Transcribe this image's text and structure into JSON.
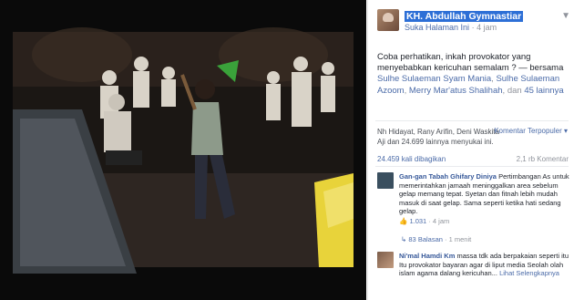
{
  "post": {
    "page_name": "KH. Abdullah Gymnastiar",
    "like_page": "Suka Halaman Ini",
    "time": "4 jam",
    "text": "Coba perhatikan, inkah provokator yang menyebabkan kericuhan semalam ? — bersama",
    "tagged_1": "Sulhe Sulaeman Syam Mania",
    "tagged_2": "Sulhe Sulaeman Azoom",
    "tagged_3": "Merry Mar'atus Shalihah",
    "and_word": "dan",
    "others": "45 lainnya",
    "likers": "Nh Hidayat, Rany Arifin, Deni Waskita Aji dan 24.699 lainnya menyukai ini.",
    "comment_filter": "Komentar Terpopuler",
    "shares": "24.459 kali dibagikan",
    "views": "2,1 rb Komentar"
  },
  "comments": [
    {
      "author": "Gan-gan Tabah Ghifary Diniya",
      "text": "Pertimbangan As untuk memerintahkan jamaah meninggalkan area sebelum gelap memang tepat. Syetan dan fitnah lebih mudah masuk di saat gelap. Sama seperti ketika hati sedang gelap.",
      "likes": "1.031",
      "time": "4 jam",
      "replies": "83 Balasan",
      "reply_time": "1 menit"
    },
    {
      "author": "Ni'mal Hamdi Km",
      "text": "massa tdk ada berpakaian seperti itu Itu provokator bayaran agar di liput media Seolah olah islam agama dalang kericuhan...",
      "more": "Lihat Selengkapnya"
    }
  ],
  "colors": {
    "accent": "#4b6ba8",
    "name_highlight": "#2d6fd6",
    "meta": "#90949c"
  }
}
